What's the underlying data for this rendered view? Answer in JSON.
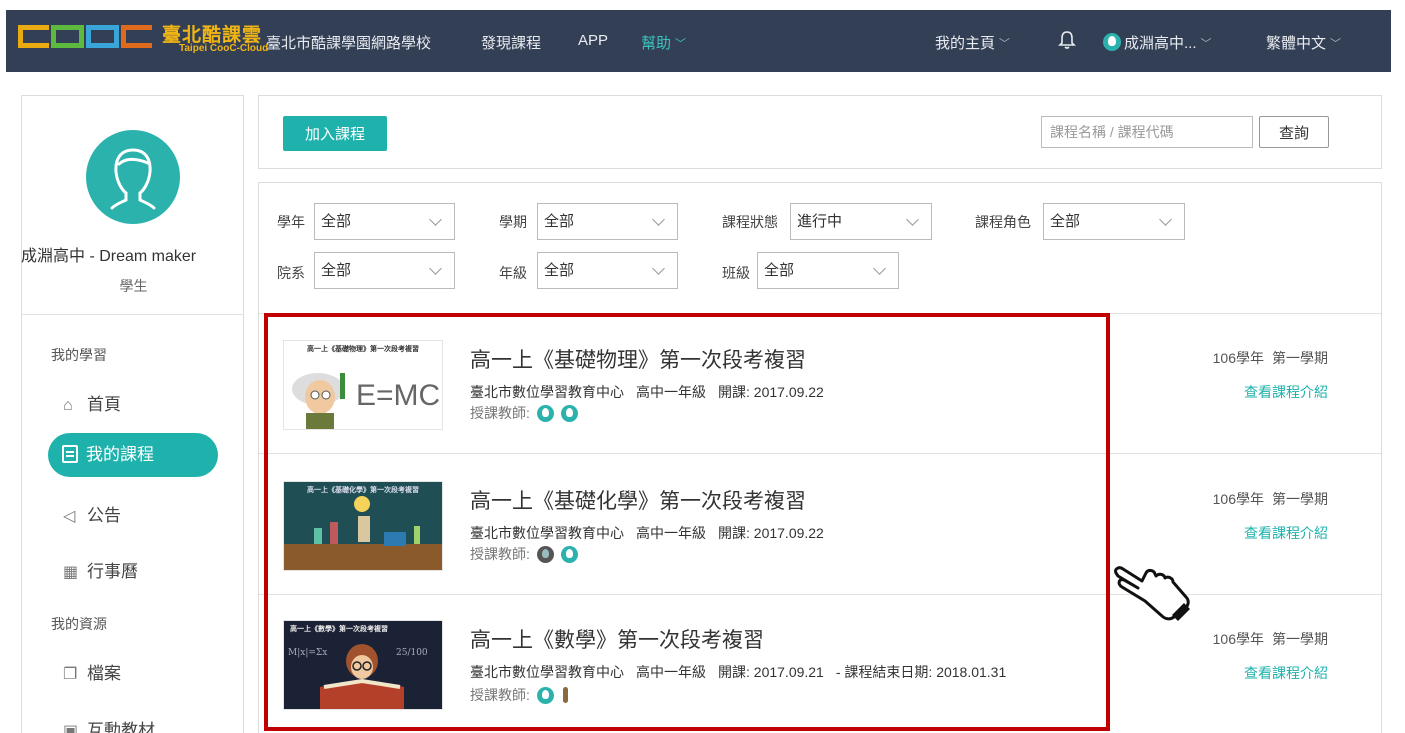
{
  "header": {
    "logo_cn": "臺北酷課雲",
    "logo_en": "Taipei CooC-Cloud",
    "school": "臺北市酷課學園網路學校",
    "nav": [
      "發現課程",
      "APP",
      "幫助"
    ],
    "my_home": "我的主頁",
    "user": "成淵高中...",
    "language": "繁體中文",
    "colors": {
      "bar": "#333f55",
      "accent": "#3cc3c0"
    }
  },
  "profile": {
    "name": "成淵高中 - Dream maker",
    "role": "學生"
  },
  "sidebar": {
    "section_learning": "我的學習",
    "section_resources": "我的資源",
    "items": [
      {
        "label": "首頁",
        "icon": "home-icon"
      },
      {
        "label": "我的課程",
        "icon": "course-icon"
      },
      {
        "label": "公告",
        "icon": "megaphone-icon"
      },
      {
        "label": "行事曆",
        "icon": "calendar-icon"
      },
      {
        "label": "檔案",
        "icon": "file-icon"
      },
      {
        "label": "互動教材",
        "icon": "interactive-icon"
      }
    ]
  },
  "toolbar": {
    "join_label": "加入課程",
    "search_placeholder": "課程名稱 / 課程代碼",
    "search_label": "查詢"
  },
  "filters": {
    "year_label": "學年",
    "year_value": "全部",
    "term_label": "學期",
    "term_value": "全部",
    "status_label": "課程狀態",
    "status_value": "進行中",
    "role_label": "課程角色",
    "role_value": "全部",
    "dept_label": "院系",
    "dept_value": "全部",
    "grade_label": "年級",
    "grade_value": "全部",
    "class_label": "班級",
    "class_value": "全部"
  },
  "courses": [
    {
      "thumb_caption": "高一上《基礎物理》第一次段考複習",
      "thumb_text": "E=MC",
      "title": "高一上《基礎物理》第一次段考複習",
      "org": "臺北市數位學習教育中心",
      "grade": "高中一年級",
      "start": "開課: 2017.09.22",
      "end": "",
      "teacher_label": "授課教師:",
      "term_year": "106學年",
      "term": "第一學期",
      "link": "查看課程介紹"
    },
    {
      "thumb_caption": "高一上《基礎化學》第一次段考複習",
      "thumb_text": "",
      "title": "高一上《基礎化學》第一次段考複習",
      "org": "臺北市數位學習教育中心",
      "grade": "高中一年級",
      "start": "開課: 2017.09.22",
      "end": "",
      "teacher_label": "授課教師:",
      "term_year": "106學年",
      "term": "第一學期",
      "link": "查看課程介紹"
    },
    {
      "thumb_caption": "高一上《數學》第一次段考複習",
      "thumb_text": "",
      "title": "高一上《數學》第一次段考複習",
      "org": "臺北市數位學習教育中心",
      "grade": "高中一年級",
      "start": "開課: 2017.09.21",
      "end": "-  課程結束日期: 2018.01.31",
      "teacher_label": "授課教師:",
      "term_year": "106學年",
      "term": "第一學期",
      "link": "查看課程介紹"
    }
  ]
}
